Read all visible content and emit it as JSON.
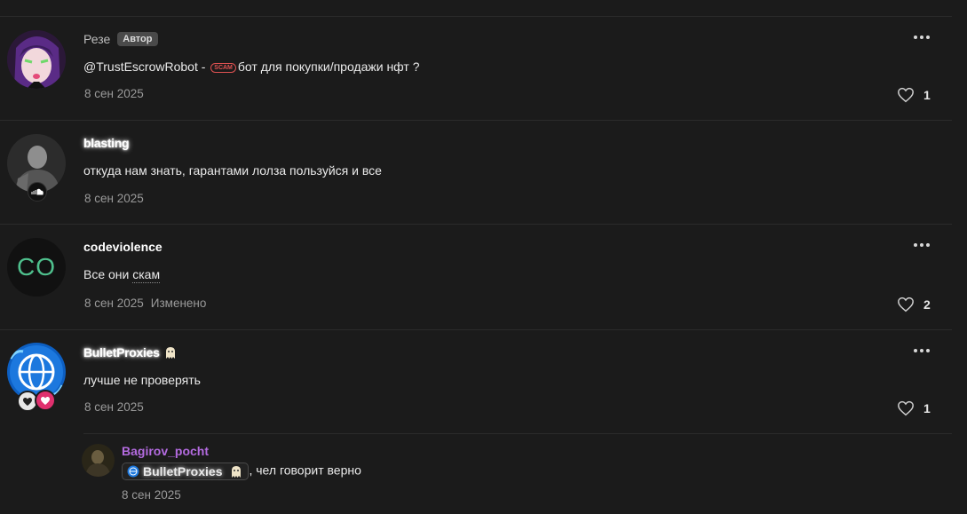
{
  "comments": [
    {
      "author": "Резе",
      "author_badge": "Автор",
      "text_mention": "@TrustEscrowRobot -",
      "scam_label": "SCAM",
      "text_rest": "бот для покупки/продажи нфт ?",
      "date": "8 сен 2025",
      "likes": "1"
    },
    {
      "author": "blasting",
      "text": "откуда нам знать, гарантами лолза пользуйся и все",
      "date": "8 сен 2025"
    },
    {
      "author": "codeviolence",
      "avatar_initials": "CO",
      "text_a": "Все они",
      "text_b": "скам",
      "date": "8 сен 2025",
      "edited": "Изменено",
      "likes": "2"
    },
    {
      "author": "BulletProxies",
      "text": "лучше не проверять",
      "date": "8 сен 2025",
      "likes": "1",
      "reply": {
        "author": "Bagirov_pocht",
        "mention": "BulletProxies",
        "text_rest": ", чел говорит верно",
        "date": "8 сен 2025"
      }
    }
  ],
  "colors": {
    "background": "#1b1b1b",
    "accent_purple": "#b46be0",
    "codeviolence_initials": "#4fc08d",
    "scam_red": "#e05252",
    "heart_pink": "#e0306e"
  }
}
